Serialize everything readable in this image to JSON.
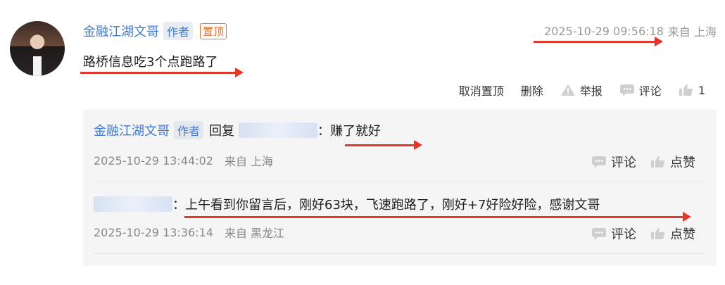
{
  "comment": {
    "author": "金融江湖文哥",
    "author_tag": "作者",
    "pinned_tag": "置顶",
    "timestamp": "2025-10-29 09:56:18",
    "location": "来自 上海",
    "text": "路桥信息吃3个点跑路了",
    "actions": {
      "unpin": "取消置顶",
      "delete": "删除",
      "report": "举报",
      "comment": "评论",
      "like_count": "1"
    }
  },
  "replies": [
    {
      "author": "金融江湖文哥",
      "author_tag": "作者",
      "reply_word": "回复",
      "target_blurred": "股友…",
      "text": "：赚了就好",
      "timestamp": "2025-10-29 13:44:02",
      "location": "来自 上海",
      "comment_label": "评论",
      "like_label": "点赞"
    },
    {
      "author_blurred": "股友…",
      "text": "：上午看到你留言后，刚好63块，飞速跑路了，刚好+7好险好险，感谢文哥",
      "timestamp": "2025-10-29 13:36:14",
      "location": "来自 黑龙江",
      "comment_label": "评论",
      "like_label": "点赞"
    }
  ]
}
